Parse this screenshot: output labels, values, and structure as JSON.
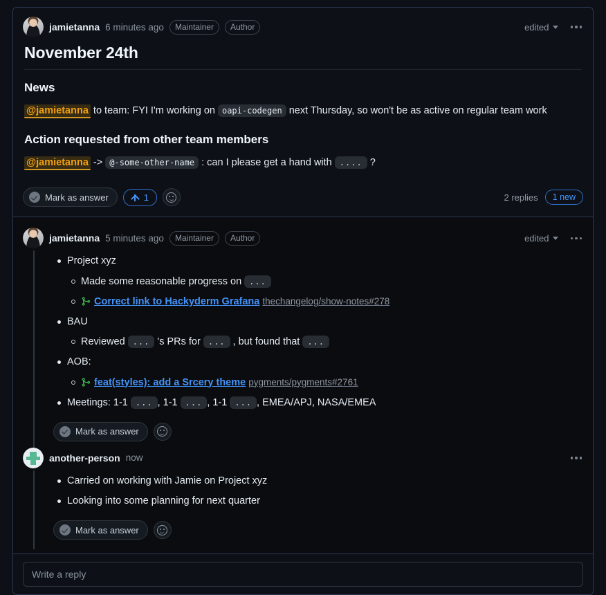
{
  "discussion": {
    "comments": [
      {
        "id": "top-comment",
        "author": "jamietanna",
        "timestamp": "6 minutes ago",
        "badges": [
          "Maintainer",
          "Author"
        ],
        "edited_label": "edited",
        "avatar_type": "photo",
        "title": "November 24th",
        "sections": [
          {
            "heading": "News",
            "line": {
              "mention": "@jamietanna",
              "text_1": " to team: FYI I'm working on ",
              "code": "oapi-codegen",
              "text_2": " next Thursday, so won't be as active on regular team work"
            }
          },
          {
            "heading": "Action requested from other team members",
            "line": {
              "mention": "@jamietanna",
              "arrow": " -> ",
              "code_name": "@-some-other-name",
              "text_1": " : can I please get a hand with ",
              "code_dots": "....",
              "text_2": " ?"
            }
          }
        ],
        "actions": {
          "mark_as_answer": "Mark as answer",
          "upvote_count": "1",
          "replies_count": "2 replies",
          "new_badge": "1 new"
        }
      },
      {
        "id": "reply-1",
        "author": "jamietanna",
        "timestamp": "5 minutes ago",
        "badges": [
          "Maintainer",
          "Author"
        ],
        "edited_label": "edited",
        "avatar_type": "photo",
        "bullets": [
          {
            "text": "Project xyz",
            "sub": [
              {
                "kind": "text",
                "text_1": "Made some reasonable progress on ",
                "code_dots": "...",
                "text_2": ""
              },
              {
                "kind": "pr",
                "link_text": "Correct link to Hackyderm Grafana",
                "repo_ref": "thechangelog/show-notes#278"
              }
            ]
          },
          {
            "text": "BAU",
            "sub": [
              {
                "kind": "text-multi",
                "parts": [
                  "Reviewed ",
                  "...",
                  " 's PRs for ",
                  "...",
                  " , but found that ",
                  "...",
                  ""
                ]
              }
            ]
          },
          {
            "text": "AOB:",
            "sub": [
              {
                "kind": "pr",
                "link_text": "feat(styles): add a Srcery theme",
                "repo_ref": "pygments/pygments#2761"
              }
            ]
          },
          {
            "kind": "meetings",
            "parts": [
              "Meetings: 1-1 ",
              "...",
              ", 1-1 ",
              "...",
              ", 1-1 ",
              "...",
              ", EMEA/APJ, NASA/EMEA"
            ]
          }
        ],
        "actions": {
          "mark_as_answer": "Mark as answer"
        }
      },
      {
        "id": "reply-2",
        "author": "another-person",
        "timestamp": "now",
        "badges": [],
        "avatar_type": "identicon",
        "bullets": [
          {
            "text": "Carried on working with Jamie on Project xyz"
          },
          {
            "text": "Looking into some planning for next quarter"
          }
        ],
        "actions": {
          "mark_as_answer": "Mark as answer"
        }
      }
    ],
    "reply_box": {
      "placeholder": "Write a reply",
      "value": ""
    }
  },
  "colors": {
    "page_background": "#0d1117",
    "replies_background": "#0a0c10",
    "frame_border": "#2c3a55",
    "accent_blue": "#4493f8",
    "accent_border_blue": "#316dca",
    "mention_amber": "#d29922",
    "merged_pr_green": "#3fb950",
    "muted_text": "#9198a1"
  }
}
